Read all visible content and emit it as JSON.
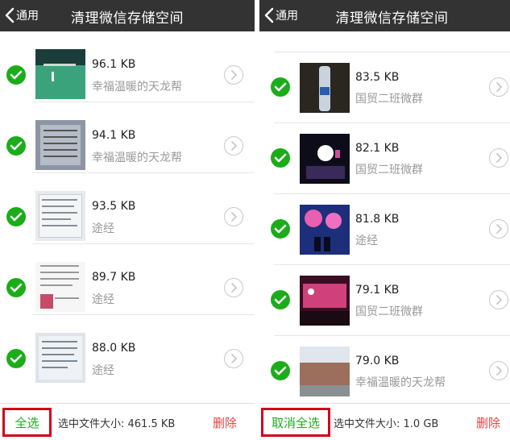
{
  "colors": {
    "header_bg": "#333333",
    "accent_green": "#1aad19",
    "delete_red": "#e64340",
    "highlight_box": "#d0021b"
  },
  "left_panel": {
    "back_label": "通用",
    "title": "清理微信存储空间",
    "items": [
      {
        "size": "96.1 KB",
        "group": "幸福温暖的天龙帮",
        "checked": true
      },
      {
        "size": "94.1 KB",
        "group": "幸福温暖的天龙帮",
        "checked": true
      },
      {
        "size": "93.5 KB",
        "group": "途经",
        "checked": true
      },
      {
        "size": "89.7 KB",
        "group": "途经",
        "checked": true
      },
      {
        "size": "88.0 KB",
        "group": "途经",
        "checked": true
      }
    ],
    "select_all_label": "全选",
    "selected_total": "选中文件大小: 461.5 KB",
    "delete_label": "删除"
  },
  "right_panel": {
    "back_label": "通用",
    "title": "清理微信存储空间",
    "items": [
      {
        "size": "83.5 KB",
        "group": "国贸二班微群",
        "checked": true
      },
      {
        "size": "82.1 KB",
        "group": "国贸二班微群",
        "checked": true
      },
      {
        "size": "81.8 KB",
        "group": "途经",
        "checked": true
      },
      {
        "size": "79.1 KB",
        "group": "国贸二班微群",
        "checked": true
      },
      {
        "size": "79.0 KB",
        "group": "幸福温暖的天龙帮",
        "checked": true
      }
    ],
    "select_all_label": "取消全选",
    "selected_total": "选中文件大小: 1.0 GB",
    "delete_label": "删除"
  }
}
